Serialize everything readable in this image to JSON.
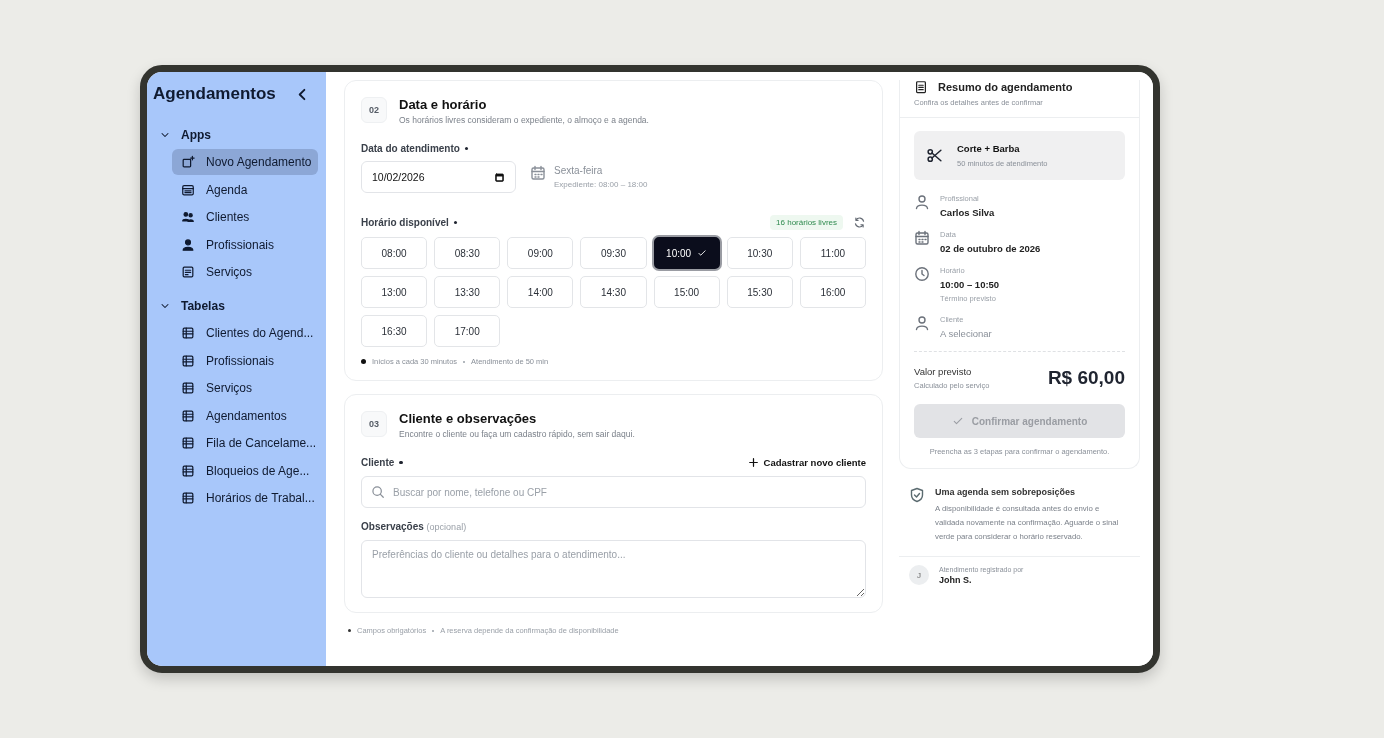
{
  "sidebar": {
    "title": "Agendamentos",
    "groups": [
      {
        "label": "Apps",
        "expanded": true,
        "items": [
          {
            "label": "Novo Agendamento",
            "kind": "compose",
            "selected": true
          },
          {
            "label": "Agenda",
            "kind": "calendar",
            "selected": false
          },
          {
            "label": "Clientes",
            "kind": "people",
            "selected": false
          },
          {
            "label": "Profissionais",
            "kind": "person",
            "selected": false
          },
          {
            "label": "Serviços",
            "kind": "document",
            "selected": false
          }
        ]
      },
      {
        "label": "Tabelas",
        "expanded": true,
        "items": [
          {
            "label": "Clientes do Agend...",
            "kind": "table",
            "selected": false
          },
          {
            "label": "Profissionais",
            "kind": "table",
            "selected": false
          },
          {
            "label": "Serviços",
            "kind": "table",
            "selected": false
          },
          {
            "label": "Agendamentos",
            "kind": "table",
            "selected": false
          },
          {
            "label": "Fila de Cancelame...",
            "kind": "table",
            "selected": false
          },
          {
            "label": "Bloqueios de Age...",
            "kind": "table",
            "selected": false
          },
          {
            "label": "Horários de Trabal...",
            "kind": "table",
            "selected": false
          }
        ]
      }
    ]
  },
  "date_step": {
    "number": "02",
    "title": "Data e horário",
    "subtitle": "Os horários livres consideram o expediente, o almoço e a agenda.",
    "date_label": "Data do atendimento",
    "date_value": "10/02/2026",
    "weekday": "Sexta-feira",
    "hours": "Expediente: 08:00 – 18:00",
    "time_label": "Horário disponível",
    "free_badge": "16 horários livres",
    "slots": [
      {
        "time": "08:00",
        "selected": false
      },
      {
        "time": "08:30",
        "selected": false
      },
      {
        "time": "09:00",
        "selected": false
      },
      {
        "time": "09:30",
        "selected": false
      },
      {
        "time": "10:00",
        "selected": true
      },
      {
        "time": "10:30",
        "selected": false
      },
      {
        "time": "11:00",
        "selected": false
      },
      {
        "time": "13:00",
        "selected": false
      },
      {
        "time": "13:30",
        "selected": false
      },
      {
        "time": "14:00",
        "selected": false
      },
      {
        "time": "14:30",
        "selected": false
      },
      {
        "time": "15:00",
        "selected": false
      },
      {
        "time": "15:30",
        "selected": false
      },
      {
        "time": "16:00",
        "selected": false
      },
      {
        "time": "16:30",
        "selected": false
      },
      {
        "time": "17:00",
        "selected": false
      }
    ],
    "notes": [
      "Inícios a cada 30 minutos",
      "Atendimento de 50 min"
    ]
  },
  "client_step": {
    "number": "03",
    "title": "Cliente e observações",
    "subtitle": "Encontre o cliente ou faça um cadastro rápido, sem sair daqui.",
    "client_label": "Cliente",
    "new_client_link": "Cadastrar novo cliente",
    "search": {
      "placeholder": "Buscar por nome, telefone ou CPF"
    },
    "notes_label": "Observações",
    "notes_optional": "(opcional)",
    "notes_field": {
      "placeholder": "Preferências do cliente ou detalhes para o atendimento..."
    }
  },
  "footer_notes": [
    "Campos obrigatórios",
    "A reserva depende da confirmação de disponibilidade"
  ],
  "summary": {
    "title": "Resumo do agendamento",
    "subtitle": "Confira os detalhes antes de confirmar",
    "service": {
      "name": "Corte + Barba",
      "duration": "50 minutos de atendimento"
    },
    "details": [
      {
        "kind": "person",
        "label": "Profissional",
        "value": "Carlos Silva",
        "pending": false
      },
      {
        "kind": "calendar",
        "label": "Data",
        "value": "02 de outubro de 2026",
        "pending": false
      },
      {
        "kind": "clock",
        "label": "Horário",
        "value": "10:00 – 10:50",
        "note": "Término previsto",
        "pending": false
      },
      {
        "kind": "person",
        "label": "Cliente",
        "value": "A selecionar",
        "pending": true
      }
    ],
    "price_label": "Valor previsto",
    "price_note": "Calculado pelo serviço",
    "price": "R$ 60,00",
    "confirm_button": {
      "label": "Confirmar agendamento",
      "disabled": true
    },
    "hint": "Preencha as 3 etapas para confirmar o agendamento."
  },
  "info": {
    "title": "Uma agenda sem sobreposições",
    "text": "A disponibilidade é consultada antes do envio e validada novamente na confirmação. Aguarde o sinal verde para considerar o horário reservado."
  },
  "registered": {
    "label": "Atendimento registrado por",
    "avatar": "J",
    "name": "John S."
  }
}
